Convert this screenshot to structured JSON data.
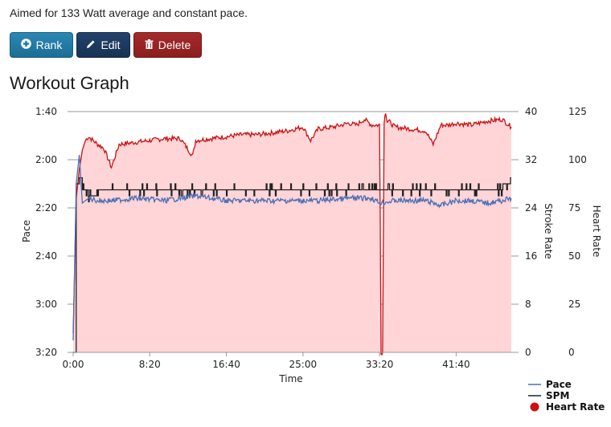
{
  "description": "Aimed for 133 Watt average and constant pace.",
  "buttons": {
    "rank": {
      "label": "Rank",
      "icon": "plus-circle-icon",
      "color": "#1f78a4"
    },
    "edit": {
      "label": "Edit",
      "icon": "pencil-icon",
      "color": "#1c3a5e"
    },
    "delete": {
      "label": "Delete",
      "icon": "trash-icon",
      "color": "#962323"
    }
  },
  "section_title": "Workout Graph",
  "chart_data": {
    "type": "line",
    "title": "Workout Graph",
    "xlabel": "Time",
    "x_tick_labels": [
      "0:00",
      "8:20",
      "16:40",
      "25:00",
      "33:20",
      "41:40"
    ],
    "x_ticks_seconds": [
      0,
      500,
      1000,
      1500,
      2000,
      2500
    ],
    "xlim_seconds": [
      0,
      2860
    ],
    "grid": true,
    "legend_position": "bottom-right",
    "axes": {
      "pace": {
        "label": "Pace",
        "side": "left",
        "tick_labels": [
          "1:40",
          "2:00",
          "2:20",
          "2:40",
          "3:00",
          "3:20"
        ],
        "ylim_seconds": [
          100,
          200
        ],
        "inverted": true
      },
      "stroke_rate": {
        "label": "Stroke Rate",
        "side": "right",
        "tick_labels": [
          "40",
          "32",
          "24",
          "16",
          "8",
          "0"
        ],
        "ylim": [
          0,
          40
        ]
      },
      "heart_rate": {
        "label": "Heart Rate",
        "side": "right-outer",
        "tick_labels": [
          "125",
          "100",
          "75",
          "50",
          "25",
          "0"
        ],
        "ylim": [
          0,
          125
        ]
      }
    },
    "series": [
      {
        "name": "Pace",
        "axis": "pace",
        "color": "#4a6fb5",
        "legend_marker": "line",
        "x": [
          0,
          20,
          40,
          60,
          100,
          160,
          250,
          400,
          600,
          800,
          1000,
          1200,
          1400,
          1600,
          1800,
          1950,
          2000,
          2100,
          2200,
          2300,
          2400,
          2500,
          2600,
          2700,
          2800,
          2860
        ],
        "values": [
          195,
          130,
          118,
          138,
          136,
          137,
          137,
          136,
          137,
          135,
          137,
          137,
          137,
          137,
          136,
          136,
          138,
          137,
          137,
          137,
          139,
          137,
          137,
          138,
          137,
          136
        ]
      },
      {
        "name": "SPM",
        "axis": "stroke_rate",
        "color": "#222222",
        "legend_marker": "line",
        "x": [
          0,
          20,
          40,
          60,
          100,
          160,
          250,
          400,
          600,
          800,
          1000,
          1200,
          1400,
          1600,
          1800,
          1950,
          2000,
          2100,
          2200,
          2300,
          2400,
          2500,
          2600,
          2700,
          2800,
          2860
        ],
        "values": [
          0,
          28,
          29,
          27,
          26,
          27,
          27,
          27,
          27,
          27,
          27,
          27,
          27,
          27,
          27,
          27,
          27,
          27,
          27,
          27,
          27,
          27,
          27,
          27,
          28,
          27
        ]
      },
      {
        "name": "Heart Rate",
        "axis": "heart_rate",
        "color": "#cc1111",
        "fill": "#ffd5d8",
        "legend_marker": "dot",
        "x": [
          0,
          20,
          40,
          60,
          80,
          100,
          130,
          160,
          200,
          250,
          300,
          400,
          500,
          600,
          700,
          780,
          800,
          900,
          1000,
          1100,
          1200,
          1300,
          1400,
          1500,
          1550,
          1600,
          1700,
          1800,
          1850,
          1900,
          1950,
          2000,
          2010,
          2020,
          2030,
          2040,
          2050,
          2060,
          2100,
          2200,
          2300,
          2350,
          2400,
          2450,
          2500,
          2600,
          2700,
          2800,
          2860
        ],
        "values": [
          10,
          80,
          95,
          105,
          110,
          112,
          110,
          108,
          106,
          96,
          108,
          109,
          110,
          111,
          111,
          102,
          110,
          111,
          112,
          113,
          113,
          114,
          115,
          117,
          110,
          116,
          117,
          119,
          118,
          121,
          118,
          118,
          0,
          0,
          120,
          125,
          120,
          120,
          117,
          116,
          115,
          108,
          118,
          118,
          119,
          118,
          120,
          121,
          117
        ]
      }
    ]
  }
}
